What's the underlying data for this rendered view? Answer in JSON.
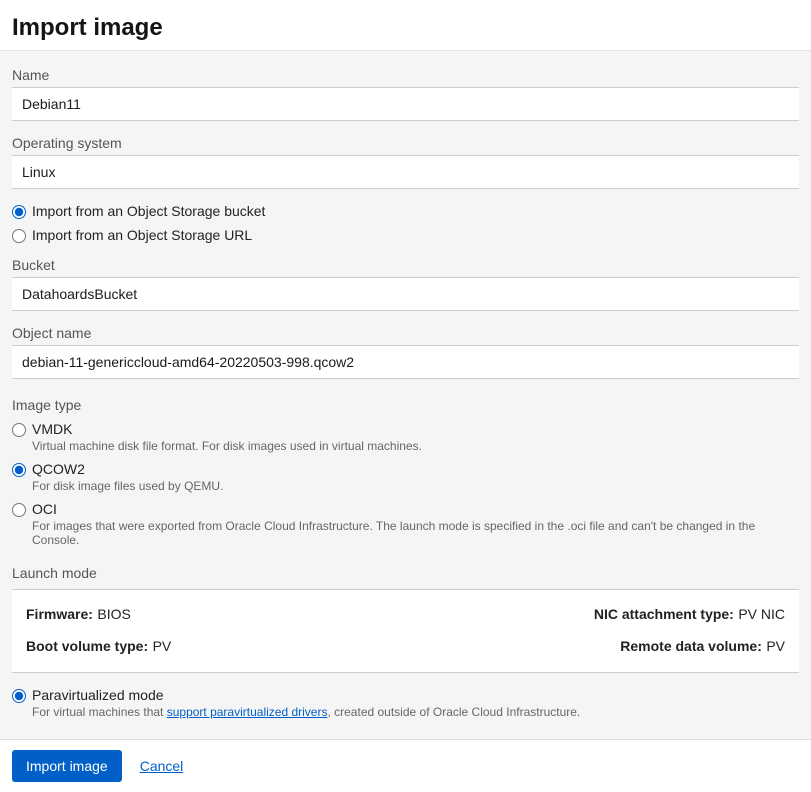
{
  "title": "Import image",
  "fields": {
    "name_label": "Name",
    "name_value": "Debian11",
    "os_label": "Operating system",
    "os_value": "Linux",
    "bucket_label": "Bucket",
    "bucket_value": "DatahoardsBucket",
    "object_label": "Object name",
    "object_value": "debian-11-genericcloud-amd64-20220503-998.qcow2"
  },
  "source_radios": {
    "bucket": "Import from an Object Storage bucket",
    "url": "Import from an Object Storage URL"
  },
  "image_type": {
    "section": "Image type",
    "vmdk_label": "VMDK",
    "vmdk_desc": "Virtual machine disk file format. For disk images used in virtual machines.",
    "qcow2_label": "QCOW2",
    "qcow2_desc": "For disk image files used by QEMU.",
    "oci_label": "OCI",
    "oci_desc": "For images that were exported from Oracle Cloud Infrastructure. The launch mode is specified in the .oci file and can't be changed in the Console."
  },
  "launch_mode": {
    "section": "Launch mode",
    "firmware_label": "Firmware:",
    "firmware_value": "BIOS",
    "boot_label": "Boot volume type:",
    "boot_value": "PV",
    "nic_label": "NIC attachment type:",
    "nic_value": "PV NIC",
    "remote_label": "Remote data volume:",
    "remote_value": "PV"
  },
  "pv_mode": {
    "label": "Paravirtualized mode",
    "desc_pre": "For virtual machines that ",
    "desc_link": "support paravirtualized drivers",
    "desc_post": ", created outside of Oracle Cloud Infrastructure."
  },
  "footer": {
    "submit": "Import image",
    "cancel": "Cancel"
  }
}
